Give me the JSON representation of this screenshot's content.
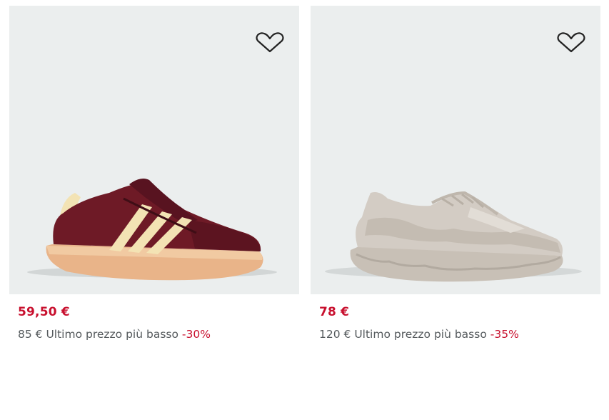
{
  "products": [
    {
      "price": "59,50 €",
      "original_price": "85 €",
      "price_note": "Ultimo prezzo più basso",
      "discount": "-30%",
      "wishlist_icon": "heart-outline-icon",
      "colors": {
        "upper": "#6e1a26",
        "stripes": "#f3e3b4",
        "sole": "#e9b489"
      }
    },
    {
      "price": "78 €",
      "original_price": "120 €",
      "price_note": "Ultimo prezzo più basso",
      "discount": "-35%",
      "wishlist_icon": "heart-outline-icon",
      "colors": {
        "upper": "#d3ccc4",
        "sole": "#c8c0b6"
      }
    }
  ],
  "colors": {
    "image_bg": "#ebeeee",
    "sale_red": "#c8102e",
    "muted_text": "#555a5d"
  }
}
